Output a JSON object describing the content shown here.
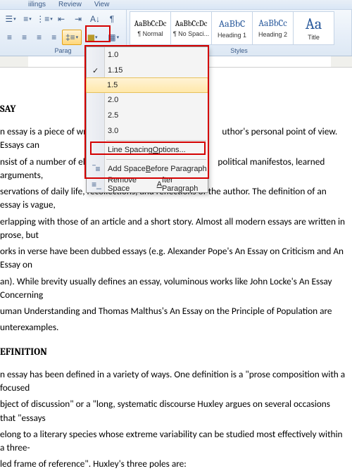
{
  "tabs": {
    "t1": "iilings",
    "t2": "Review",
    "t3": "View"
  },
  "paragraph_group_label": "Parag",
  "styles_group_label": "Styles",
  "styles": [
    {
      "sample": "AaBbCcDc",
      "name": "¶ Normal",
      "size": "11px",
      "color": "#000"
    },
    {
      "sample": "AaBbCcDc",
      "name": "¶ No Spaci...",
      "size": "11px",
      "color": "#000"
    },
    {
      "sample": "AaBbC",
      "name": "Heading 1",
      "size": "14px",
      "color": "#2a5a9c"
    },
    {
      "sample": "AaBbCc",
      "name": "Heading 2",
      "size": "13px",
      "color": "#2a5a9c"
    },
    {
      "sample": "Aa",
      "name": "Title",
      "size": "20px",
      "color": "#2a5a9c"
    }
  ],
  "menu": {
    "o1": "1.0",
    "o2": "1.15",
    "o3": "1.5",
    "o4": "2.0",
    "o5": "2.5",
    "o6": "3.0",
    "opt_label_pre": "Line Spacing ",
    "opt_label_u": "O",
    "opt_label_post": "ptions...",
    "before_pre": "Add Space ",
    "before_u": "B",
    "before_post": "efore Paragraph",
    "after_pre": "Remove Space ",
    "after_u": "A",
    "after_post": "fter Paragraph"
  },
  "doc": {
    "h1": "SAY",
    "p1": "n essay is a piece of writin",
    "p1b": "uthor's personal point of view. Essays can",
    "p2": "nsist of a number of elen",
    "p2b": "political manifestos, learned arguments,",
    "p3": "servations of daily life, recollections, and reflections of the author. The definition of an essay is vague,",
    "p4": "erlapping with those of an article  and a short story. Almost all modern essays are written in prose, but",
    "p5": "orks in verse have been dubbed essays (e.g. Alexander Pope's An Essay on Criticism and An Essay on",
    "p6": "an). While brevity usually defines an essay, voluminous works like John Locke's An Essay Concerning",
    "p7": "uman Understanding and Thomas Malthus's An Essay on the Principle of Population are",
    "p8": "unterexamples.",
    "h2": "EFINITION",
    "p9": "n essay has been defined in a variety of ways. One definition is a \"prose composition with a focused",
    "p10": "bject of discussion\" or a \"long, systematic discourse Huxley argues on several occasions that \"essays",
    "p11": "elong to a literary species whose extreme variability can be studied most effectively within a three-",
    "p12": "led frame of reference\". Huxley's three poles are:"
  }
}
